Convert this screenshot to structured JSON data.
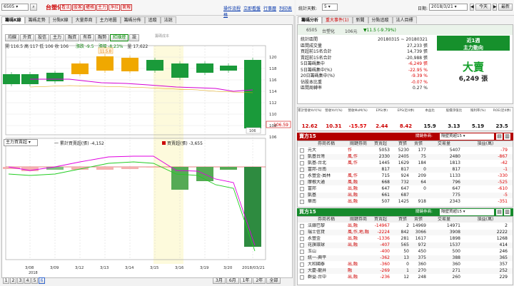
{
  "top": {
    "stock_code": "6505",
    "stock_name": "台塑化",
    "red_buttons": [
      "看法",
      "股客",
      "權格",
      "主力",
      "淨拉",
      "氣報"
    ],
    "links": [
      "操作流程",
      "立即看盤",
      "行事曆",
      "列印表格"
    ],
    "tabs": [
      "籌碼K線",
      "籌碼走勢",
      "分點K線",
      "大量券商",
      "主力地圖",
      "籌碼分佈",
      "追蹤",
      "法說"
    ],
    "sub_buttons": [
      "均線",
      "外資",
      "投信",
      "主力",
      "融資",
      "有券",
      "融勢",
      "紅綠燈",
      "設"
    ],
    "ohlc": "開 116.5 高 117 低 106 收 106",
    "change": "漲跌 -9.5",
    "pct": "漲幅 -8.23%",
    "volume": "量 17,622",
    "annotation": "11.5.8",
    "bottom_label": "籌碼成本",
    "price_last": "106.59",
    "price_last_tag": "106",
    "indicator_select": "主力買賣超",
    "legend1": "一 累計買賣超(張) -4,152",
    "legend2": "買賣超(張) -3,655",
    "x_labels": [
      "3/08",
      "3/09",
      "3/12",
      "3/13",
      "3/14",
      "3/15",
      "3/16",
      "3/19",
      "3/20",
      "2018/03/21"
    ],
    "year_label": "2018",
    "pages": [
      "1",
      "2",
      "3",
      "4",
      "5",
      "6"
    ],
    "ranges": [
      "3月",
      "6月",
      "1年",
      "2年",
      "全部"
    ],
    "y_top_label": "-120",
    "y_labels": [
      "120",
      "118",
      "116",
      "114",
      "112",
      "110",
      "108",
      "106"
    ]
  },
  "right": {
    "days_label": "統計天數:",
    "days_value": "5",
    "tabs": [
      "籌碼分析",
      "重大事件(1)",
      "新聞",
      "分點追蹤",
      "法人目標"
    ],
    "date_label": "日期:",
    "date_value": "2018/3/21",
    "today_btn": "今天",
    "recent_btn": "最新",
    "header_code": "6505",
    "header_name": "台塑化",
    "header_price": "106元",
    "header_change": "▼11.5 (-9.79%)",
    "trend_title": "近1週",
    "trend_sub": "主力動向",
    "stats": [
      {
        "k": "統計區間",
        "v": "20180315 ~ 20180321"
      },
      {
        "k": "區間成交量",
        "v": "27,233 張"
      },
      {
        "k": "買超前15名合計",
        "v": "14,739 張"
      },
      {
        "k": "賣超前15名合計",
        "v": "-20,988 張"
      },
      {
        "k": "5日籌碼集中",
        "v": "-6,249 張"
      },
      {
        "k": "5日籌碼集中(%)",
        "v": "-22.95 %"
      },
      {
        "k": "20日籌碼集中(%)",
        "v": "-9.39 %"
      },
      {
        "k": "佔股本比重",
        "v": "-0.07 %"
      },
      {
        "k": "區間周轉率",
        "v": "0.27 %"
      }
    ],
    "big_label": "大賣",
    "big_value": "6,249 張",
    "metrics_head": [
      "累計營收YoY(%)",
      "營收YoY(%)",
      "營收MoM(%)",
      "EPS(季)",
      "EPS(近4季)",
      "本益比",
      "股價淨值比",
      "殖利率(%)",
      "ROE(近4季)"
    ],
    "metrics_vals": [
      "12.62",
      "10.31",
      "-15.57",
      "2.44",
      "8.42",
      "15.9",
      "3.13",
      "5.19",
      "23.5"
    ],
    "sell_title": "賣方15",
    "buy_title": "買方15",
    "link_label": "關鍵券商:",
    "link_select": "隔壁買超15",
    "col_heads": [
      "券商名稱",
      "關鍵券商",
      "買賣超",
      "買張",
      "賣張",
      "交易量",
      "損益(萬)"
    ],
    "sell_rows": [
      [
        "元大",
        "作",
        "5053",
        "5230",
        "177",
        "5407",
        "-79"
      ],
      [
        "凱基台灣",
        "風,作",
        "2330",
        "2405",
        "75",
        "2480",
        "-867"
      ],
      [
        "凱基-台北",
        "風,作",
        "1445",
        "1629",
        "184",
        "1813",
        "-42"
      ],
      [
        "富邦-台南",
        "",
        "817",
        "817",
        "0",
        "817",
        "-1"
      ],
      [
        "永豐金-員林",
        "風,作",
        "715",
        "924",
        "209",
        "1133",
        "-330"
      ],
      [
        "摩根大通",
        "風,融",
        "668",
        "732",
        "64",
        "796",
        "-525"
      ],
      [
        "富邦",
        "出,融",
        "647",
        "647",
        "0",
        "647",
        "-610"
      ],
      [
        "凱基",
        "出,融",
        "661",
        "687",
        "",
        "775",
        "-5"
      ],
      [
        "華南",
        "出,融",
        "507",
        "1425",
        "918",
        "2343",
        "-351"
      ]
    ],
    "buy_rows": [
      [
        "法銀巴黎",
        "出,融",
        "-14967",
        "2",
        "14969",
        "14971",
        "2"
      ],
      [
        "瑞士信貸",
        "風,作,地,融",
        "-2224",
        "842",
        "3066",
        "3908",
        "2222"
      ],
      [
        "永豐金",
        "出,融",
        "-1336",
        "281",
        "1617",
        "1898",
        "1268"
      ],
      [
        "花旗環球",
        "出,融",
        "-407",
        "565",
        "972",
        "1537",
        "414"
      ],
      [
        "玉山",
        "",
        "-400",
        "50",
        "450",
        "500",
        "246"
      ],
      [
        "統一-興平",
        "",
        "-362",
        "13",
        "375",
        "388",
        "365"
      ],
      [
        "大和國泰",
        "出,融",
        "-360",
        "0",
        "360",
        "360",
        "357"
      ],
      [
        "大慶-龍井",
        "融",
        "-269",
        "1",
        "270",
        "271",
        "252"
      ],
      [
        "群益-台中",
        "出,融",
        "-236",
        "12",
        "248",
        "260",
        "229"
      ]
    ]
  }
}
